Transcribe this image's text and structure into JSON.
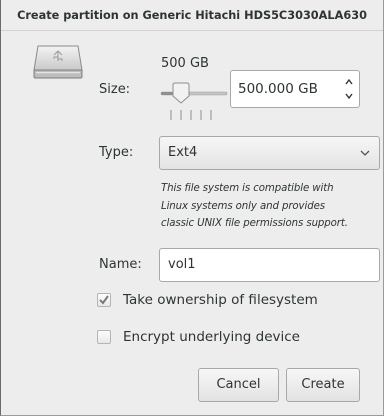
{
  "window": {
    "title": "Create partition on Generic Hitachi HDS5C3030ALA630"
  },
  "icons": {
    "disk": "drive-harddisk-usb-icon",
    "spin_up": "chevron-up-icon",
    "spin_down": "chevron-down-icon",
    "combo_arrow": "chevron-down-icon",
    "checkmark": "checkmark-icon"
  },
  "size": {
    "label": "Size:",
    "display": "500 GB",
    "spin_value": "500.000 GB",
    "slider_fraction": 0.35
  },
  "type": {
    "label": "Type:",
    "selected": "Ext4",
    "hint_lines": [
      "This file system is compatible with",
      "Linux systems only and provides",
      "classic UNIX file permissions support."
    ]
  },
  "name": {
    "label": "Name:",
    "value": "vol1"
  },
  "options": {
    "take_ownership": {
      "label": "Take ownership of filesystem",
      "checked": true
    },
    "encrypt": {
      "label": "Encrypt underlying device",
      "checked": false
    }
  },
  "buttons": {
    "cancel": "Cancel",
    "create": "Create"
  },
  "colors": {
    "dialog_bg": "#ededed",
    "text": "#2e3436",
    "border": "#a8a8a8"
  }
}
